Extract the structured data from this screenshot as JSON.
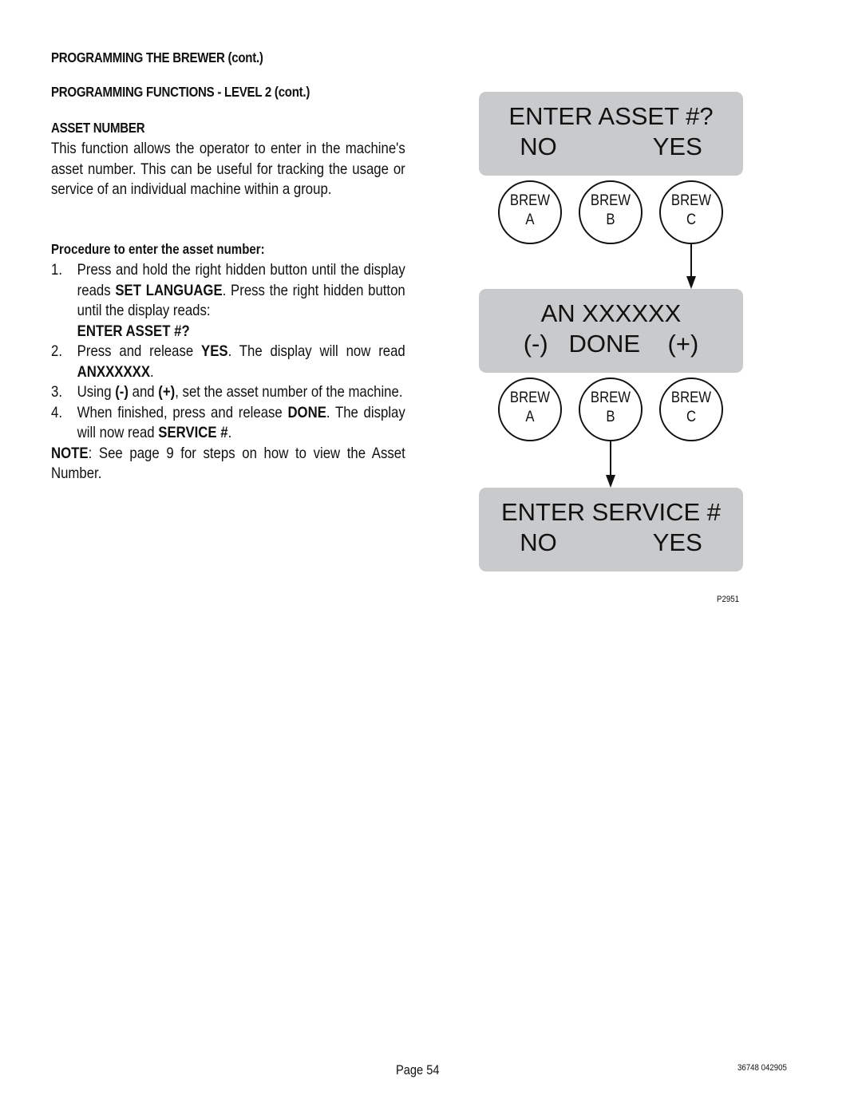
{
  "headings": {
    "section": "PROGRAMMING THE BREWER (cont.)",
    "subsection": "PROGRAMMING FUNCTIONS - LEVEL  2 (cont.)",
    "topic": "ASSET NUMBER"
  },
  "intro": "This function allows the operator to enter in the machine's asset number. This can be useful for tracking the usage or service of an individual machine within a group.",
  "procedure": {
    "title": "Procedure to enter the asset number:",
    "steps": [
      {
        "num": "1.",
        "parts": [
          "Press and hold the right hidden button until the display reads ",
          "SET LANGUAGE",
          ". Press the right hidden button until the display reads:",
          "ENTER ASSET #?"
        ]
      },
      {
        "num": "2.",
        "parts": [
          "Press and release ",
          "YES",
          ". The display will now read ",
          "ANXXXXXX",
          "."
        ]
      },
      {
        "num": "3.",
        "parts": [
          "Using ",
          "(-)",
          " and ",
          "(+)",
          ", set the asset number of the machine."
        ]
      },
      {
        "num": "4.",
        "parts": [
          "When finished, press and release ",
          "DONE",
          ". The display will now read ",
          "SERVICE #",
          "."
        ]
      }
    ],
    "note_label": "NOTE",
    "note_text": ": See page 9 for steps on how to view the Asset Number."
  },
  "diagram": {
    "panels": [
      {
        "line1": "ENTER ASSET #?",
        "line2": "NO              YES"
      },
      {
        "line1": "AN XXXXXX",
        "line2": "(-)   DONE    (+)"
      },
      {
        "line1": "ENTER SERVICE #",
        "line2": "NO              YES"
      }
    ],
    "buttons": [
      {
        "top": "BREW",
        "bottom": "A"
      },
      {
        "top": "BREW",
        "bottom": "B"
      },
      {
        "top": "BREW",
        "bottom": "C"
      }
    ],
    "figure_code": "P2951"
  },
  "footer": {
    "page": "Page 54",
    "doc_code": "36748 042905"
  }
}
